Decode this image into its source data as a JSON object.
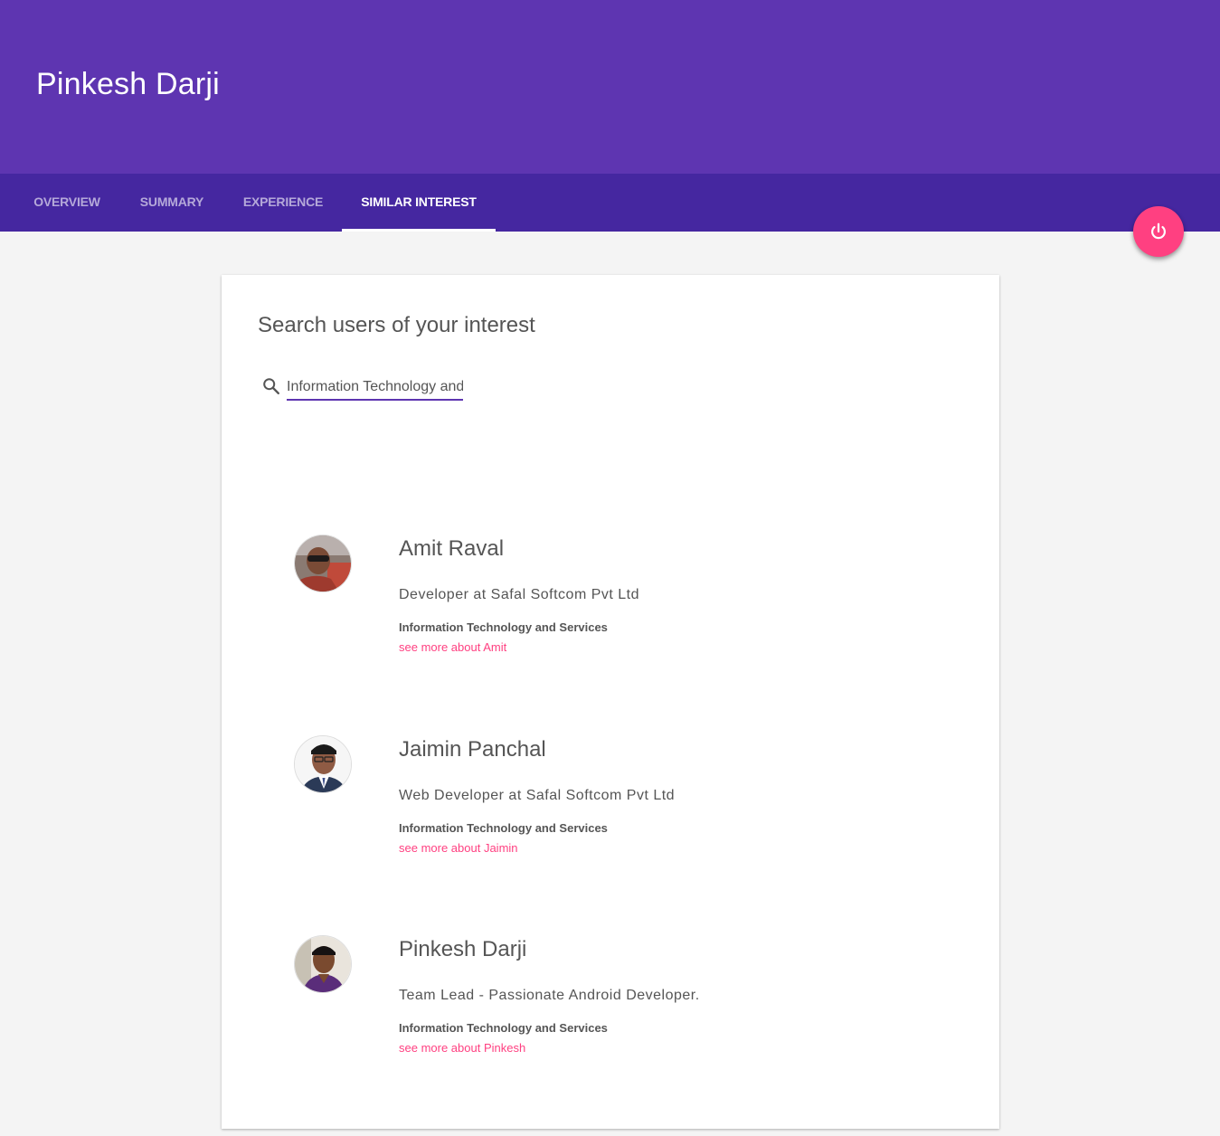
{
  "header": {
    "title": "Pinkesh Darji"
  },
  "tabs": [
    {
      "label": "OVERVIEW",
      "active": false
    },
    {
      "label": "SUMMARY",
      "active": false
    },
    {
      "label": "EXPERIENCE",
      "active": false
    },
    {
      "label": "SIMILAR INTEREST",
      "active": true
    }
  ],
  "fab": {
    "icon": "power-icon"
  },
  "search": {
    "title": "Search users of your interest",
    "value": "Information Technology and",
    "icon": "search-icon"
  },
  "users": [
    {
      "name": "Amit Raval",
      "headline": "Developer at Safal Softcom Pvt Ltd",
      "industry": "Information Technology and Services",
      "link": "see more about Amit"
    },
    {
      "name": "Jaimin Panchal",
      "headline": "Web Developer at Safal Softcom Pvt Ltd",
      "industry": "Information Technology and Services",
      "link": "see more about Jaimin"
    },
    {
      "name": "Pinkesh Darji",
      "headline": "Team Lead - Passionate Android Developer.",
      "industry": "Information Technology and Services",
      "link": "see more about Pinkesh"
    }
  ],
  "colors": {
    "header": "#5e35b1",
    "tabbar": "#4527a0",
    "accent": "#ff4081",
    "background": "#f4f4f4"
  }
}
